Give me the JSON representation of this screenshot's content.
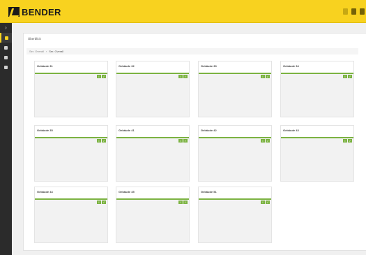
{
  "header": {
    "logo_text": "BENDER"
  },
  "panel": {
    "title": "Überblick",
    "refresh_icon": "refresh-icon"
  },
  "breadcrumb": {
    "items": [
      "Ser. Overall",
      "Ser. Overall"
    ]
  },
  "cards": [
    {
      "title": "Gebäude 31"
    },
    {
      "title": "Gebäude 32"
    },
    {
      "title": "Gebäude 33"
    },
    {
      "title": "Gebäude 34"
    },
    {
      "title": "Gebäude 35"
    },
    {
      "title": "Gebäude 41"
    },
    {
      "title": "Gebäude 42"
    },
    {
      "title": "Gebäude 43"
    },
    {
      "title": "Gebäude 44"
    },
    {
      "title": "Gebäude 45"
    },
    {
      "title": "Gebäude 51"
    }
  ],
  "colors": {
    "accent": "#f8d21f",
    "status_ok": "#7cb342",
    "sidebar": "#2b2b2b"
  },
  "card_buttons": {
    "info_label": "i",
    "ok_label": "✓"
  }
}
